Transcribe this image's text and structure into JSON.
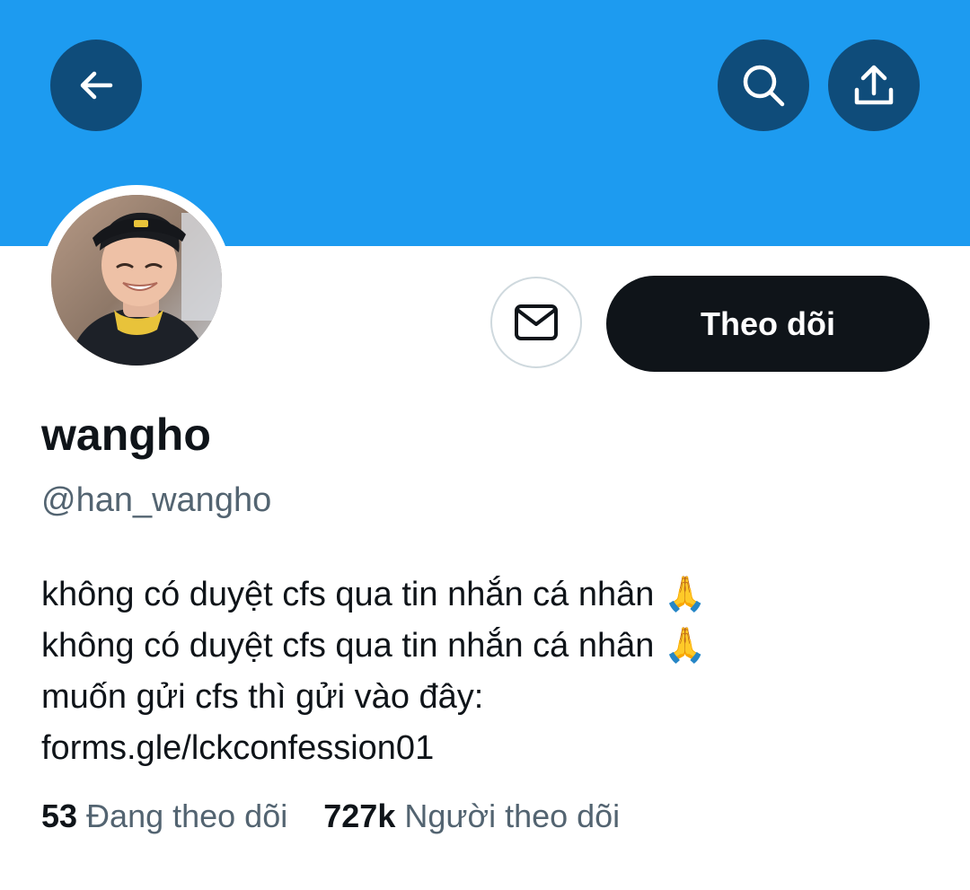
{
  "header": {
    "banner_color": "#1d9bf0",
    "back_icon": "arrow-left-icon",
    "search_icon": "search-icon",
    "share_icon": "share-upload-icon"
  },
  "profile": {
    "display_name": "wangho",
    "handle": "@han_wangho",
    "bio_lines": [
      "không có duyệt cfs qua tin nhắn cá nhân 🙏",
      "không có duyệt cfs qua tin nhắn cá nhân 🙏",
      "muốn gửi cfs thì gửi vào đây:"
    ],
    "bio_link": "forms.gle/lckconfession01"
  },
  "actions": {
    "message_icon": "mail-icon",
    "follow_label": "Theo dõi"
  },
  "stats": {
    "following_count": "53",
    "following_label": "Đang theo dõi",
    "followers_count": "727k",
    "followers_label": "Người theo dõi"
  },
  "colors": {
    "accent": "#1d9bf0",
    "header_button": "#0f4c7a",
    "text_primary": "#0f1419",
    "text_secondary": "#536471",
    "follow_button": "#0f1419"
  }
}
